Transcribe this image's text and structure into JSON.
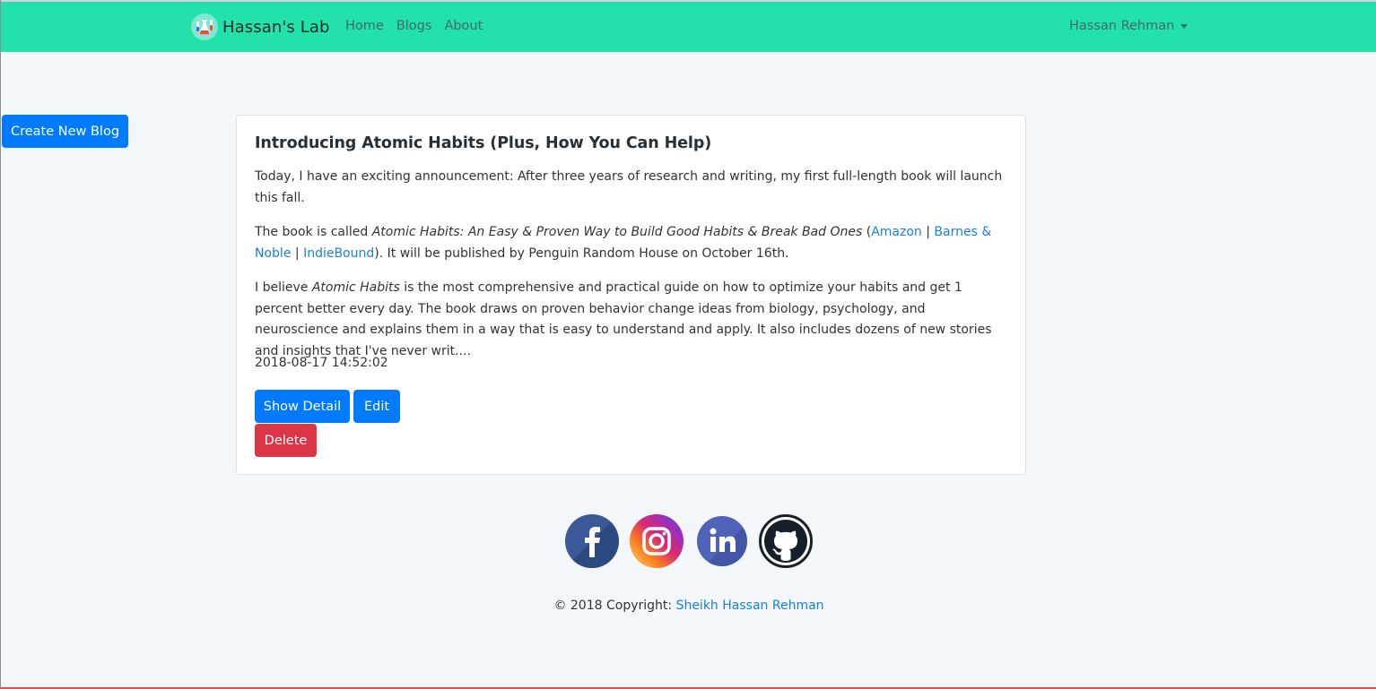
{
  "navbar": {
    "brand": "Hassan's Lab",
    "links": [
      "Home",
      "Blogs",
      "About"
    ],
    "user": "Hassan Rehman",
    "brand_icon": "lab-flask-icon",
    "colors": {
      "background": "#22e2aa"
    }
  },
  "sidebar": {
    "create_button": "Create New Blog"
  },
  "post": {
    "title": "Introducing Atomic Habits (Plus, How You Can Help)",
    "para1": "Today, I have an exciting announcement: After three years of research and writing, my first full-length book will launch this fall.",
    "para2_prefix": "The book is called ",
    "book_title": "Atomic Habits: An Easy & Proven Way to Build Good Habits & Break Bad Ones",
    "para2_open": " (",
    "link_amazon": "Amazon",
    "sep": " | ",
    "link_bn": "Barnes & Noble",
    "link_indie": "IndieBound",
    "para2_suffix": "). It will be published by Penguin Random House on October 16th.",
    "para3_prefix": "I believe ",
    "para3_em": "Atomic Habits",
    "para3_suffix": " is the most comprehensive and practical guide on how to optimize your habits and get 1 percent better every day. The book draws on proven behavior change ideas from biology, psychology, and neuroscience and explains them in a way that is easy to understand and apply. It also includes dozens of new stories and insights that I've never writ....",
    "date": "2018-08-17 14:52:02",
    "buttons": {
      "show": "Show Detail",
      "edit": "Edit",
      "delete": "Delete"
    }
  },
  "social": {
    "icons": [
      "facebook-icon",
      "instagram-icon",
      "linkedin-icon",
      "github-icon"
    ]
  },
  "footer": {
    "prefix": "© 2018 Copyright: ",
    "link": "Sheikh Hassan Rehman"
  },
  "colors": {
    "primary": "#007bff",
    "danger": "#dc3545",
    "link": "#1a7fe0",
    "page_bg": "#f4f7fa"
  }
}
